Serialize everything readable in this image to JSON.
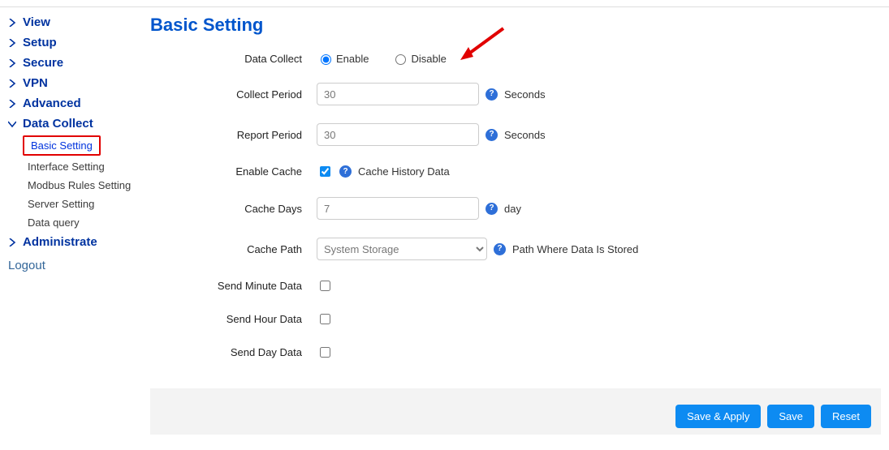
{
  "sidebar": {
    "items": [
      {
        "label": "View",
        "expanded": false
      },
      {
        "label": "Setup",
        "expanded": false
      },
      {
        "label": "Secure",
        "expanded": false
      },
      {
        "label": "VPN",
        "expanded": false
      },
      {
        "label": "Advanced",
        "expanded": false
      },
      {
        "label": "Data Collect",
        "expanded": true
      },
      {
        "label": "Administrate",
        "expanded": false
      }
    ],
    "data_collect_sub": [
      {
        "label": "Basic Setting",
        "active": true
      },
      {
        "label": "Interface Setting"
      },
      {
        "label": "Modbus Rules Setting"
      },
      {
        "label": "Server Setting"
      },
      {
        "label": "Data query"
      }
    ],
    "logout": "Logout"
  },
  "page": {
    "title": "Basic Setting"
  },
  "form": {
    "data_collect": {
      "label": "Data Collect",
      "enable": "Enable",
      "disable": "Disable",
      "value": "enable"
    },
    "collect_period": {
      "label": "Collect Period",
      "value": "30",
      "unit": "Seconds"
    },
    "report_period": {
      "label": "Report Period",
      "value": "30",
      "unit": "Seconds"
    },
    "enable_cache": {
      "label": "Enable Cache",
      "checked": true,
      "help_text": "Cache History Data"
    },
    "cache_days": {
      "label": "Cache Days",
      "value": "7",
      "unit": "day"
    },
    "cache_path": {
      "label": "Cache Path",
      "value": "System Storage",
      "help_text": "Path Where Data Is Stored"
    },
    "send_minute": {
      "label": "Send Minute Data",
      "checked": false
    },
    "send_hour": {
      "label": "Send Hour Data",
      "checked": false
    },
    "send_day": {
      "label": "Send Day Data",
      "checked": false
    }
  },
  "buttons": {
    "save_apply": "Save & Apply",
    "save": "Save",
    "reset": "Reset"
  }
}
